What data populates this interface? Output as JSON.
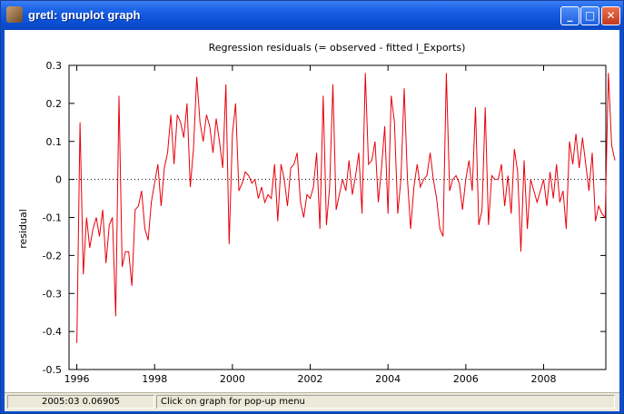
{
  "window": {
    "title": "gretl: gnuplot graph",
    "icon": "gretl-app-icon",
    "buttons": {
      "minimize": "_",
      "maximize": "□",
      "close": "✕"
    }
  },
  "chart_data": {
    "type": "line",
    "title": "Regression residuals (= observed - fitted l_Exports)",
    "xlabel": "",
    "ylabel": "residual",
    "xlim": [
      1995.8,
      2009.6
    ],
    "ylim": [
      -0.5,
      0.3
    ],
    "x_ticks": [
      "1996",
      "1998",
      "2000",
      "2002",
      "2004",
      "2006",
      "2008"
    ],
    "y_ticks": [
      "0.3",
      "0.2",
      "0.1",
      "0",
      "-0.1",
      "-0.2",
      "-0.3",
      "-0.4",
      "-0.5"
    ],
    "zero_line": true,
    "line_color": "#e8000b",
    "series": [
      {
        "x_start": 1996.0,
        "x_step": 0.08333,
        "values": [
          -0.43,
          0.15,
          -0.25,
          -0.1,
          -0.18,
          -0.13,
          -0.1,
          -0.15,
          -0.08,
          -0.22,
          -0.12,
          -0.1,
          -0.36,
          0.22,
          -0.23,
          -0.19,
          -0.19,
          -0.28,
          -0.08,
          -0.07,
          -0.03,
          -0.13,
          -0.16,
          -0.06,
          -0.01,
          0.04,
          -0.07,
          0.03,
          0.07,
          0.17,
          0.04,
          0.17,
          0.15,
          0.11,
          0.2,
          -0.02,
          0.08,
          0.27,
          0.15,
          0.1,
          0.17,
          0.14,
          0.07,
          0.16,
          0.1,
          0.03,
          0.25,
          -0.17,
          0.12,
          0.2,
          -0.03,
          -0.01,
          0.02,
          0.01,
          -0.01,
          0.0,
          -0.05,
          -0.02,
          -0.06,
          -0.04,
          -0.05,
          0.04,
          -0.11,
          0.04,
          0.0,
          -0.07,
          0.03,
          0.04,
          0.07,
          -0.06,
          -0.1,
          -0.04,
          -0.05,
          -0.02,
          0.07,
          -0.13,
          0.22,
          -0.12,
          -0.02,
          0.25,
          -0.08,
          -0.04,
          0.0,
          -0.03,
          0.05,
          -0.04,
          0.01,
          0.07,
          -0.09,
          0.28,
          0.04,
          0.05,
          0.1,
          -0.06,
          0.03,
          0.14,
          -0.09,
          0.22,
          0.15,
          -0.09,
          0.0,
          0.24,
          0.0,
          -0.13,
          -0.02,
          0.04,
          -0.02,
          0.0,
          0.01,
          0.07,
          0.0,
          -0.05,
          -0.13,
          -0.15,
          0.28,
          -0.03,
          0.0,
          0.01,
          -0.01,
          -0.08,
          0.0,
          0.05,
          -0.03,
          0.19,
          -0.12,
          -0.08,
          0.19,
          -0.12,
          0.01,
          0.0,
          0.0,
          0.04,
          -0.07,
          0.01,
          -0.09,
          0.08,
          0.02,
          -0.19,
          0.05,
          -0.13,
          0.0,
          -0.03,
          -0.06,
          -0.03,
          0.0,
          -0.07,
          0.02,
          -0.05,
          0.04,
          -0.06,
          -0.03,
          -0.13,
          0.1,
          0.04,
          0.12,
          0.03,
          0.11,
          0.04,
          -0.03,
          0.07,
          -0.11,
          -0.07,
          -0.09,
          -0.1,
          0.28,
          0.09,
          0.05
        ]
      }
    ]
  },
  "status": {
    "coords": "2005:03 0.06905",
    "hint": "Click on graph for pop-up menu"
  }
}
